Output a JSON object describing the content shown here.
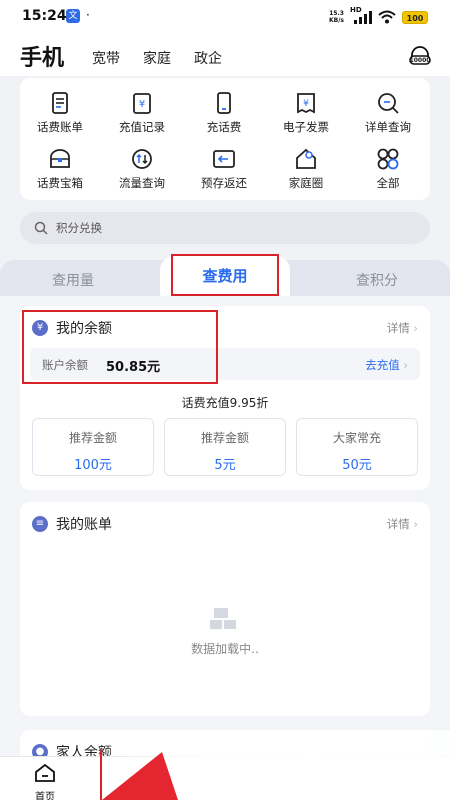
{
  "status_bar": {
    "time": "15:24",
    "app_badge": "文",
    "dot": "·",
    "speed_value": "15.3",
    "speed_unit": "KB/s",
    "hd_label": "HD",
    "battery": "100"
  },
  "header": {
    "title": "手机",
    "nav": [
      "宽带",
      "家庭",
      "政企"
    ],
    "cs_label": "10000"
  },
  "quick_grid": [
    {
      "label": "话费账单",
      "icon": "bill-icon"
    },
    {
      "label": "充值记录",
      "icon": "recharge-record-icon"
    },
    {
      "label": "充话费",
      "icon": "phone-recharge-icon"
    },
    {
      "label": "电子发票",
      "icon": "invoice-icon"
    },
    {
      "label": "详单查询",
      "icon": "detail-query-icon"
    },
    {
      "label": "话费宝箱",
      "icon": "treasure-box-icon"
    },
    {
      "label": "流量查询",
      "icon": "data-query-icon"
    },
    {
      "label": "预存返还",
      "icon": "prestore-return-icon"
    },
    {
      "label": "家庭圈",
      "icon": "family-circle-icon"
    },
    {
      "label": "全部",
      "icon": "all-apps-icon"
    }
  ],
  "search": {
    "placeholder": "积分兑换"
  },
  "tabs": {
    "left": "查用量",
    "active": "查费用",
    "right": "查积分"
  },
  "balance": {
    "icon_glyph": "¥",
    "title": "我的余额",
    "detail": "详情",
    "account_label": "账户余额",
    "account_value": "50.85元",
    "recharge_link": "去充值",
    "promo": "话费充值9.95折",
    "options": [
      {
        "label": "推荐金额",
        "value": "100元"
      },
      {
        "label": "推荐金额",
        "value": "5元"
      },
      {
        "label": "大家常充",
        "value": "50元"
      }
    ]
  },
  "bill": {
    "title": "我的账单",
    "detail": "详情",
    "loading": "数据加载中.."
  },
  "family": {
    "title": "家人余额"
  },
  "bottom_nav": {
    "home": "首页"
  }
}
